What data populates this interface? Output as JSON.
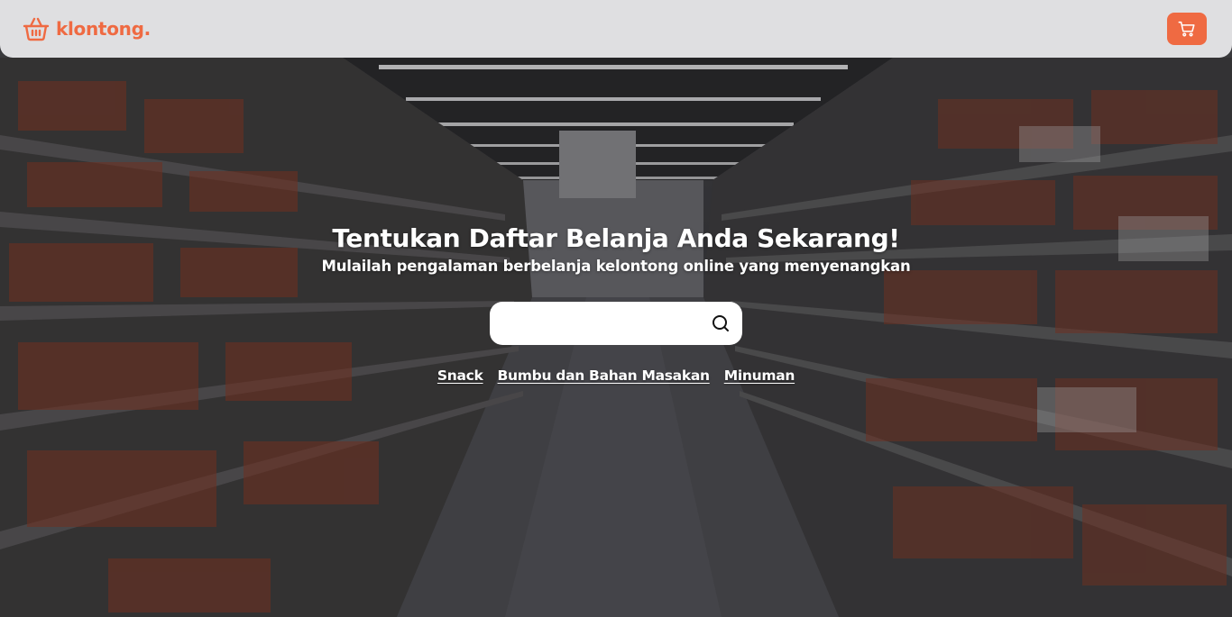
{
  "brand": {
    "name": "klontong.",
    "color": "#ef6a42"
  },
  "navbar": {
    "cart_icon": "shopping-cart-icon",
    "cart_color": "#ef6a42"
  },
  "hero": {
    "title": "Tentukan Daftar Belanja Anda Sekarang!",
    "subtitle": "Mulailah pengalaman berbelanja kelontong online yang menyenangkan"
  },
  "search": {
    "value": "",
    "placeholder": "",
    "icon": "search-icon"
  },
  "categories": [
    {
      "label": "Snack"
    },
    {
      "label": "Bumbu dan Bahan Masakan"
    },
    {
      "label": "Minuman"
    }
  ]
}
